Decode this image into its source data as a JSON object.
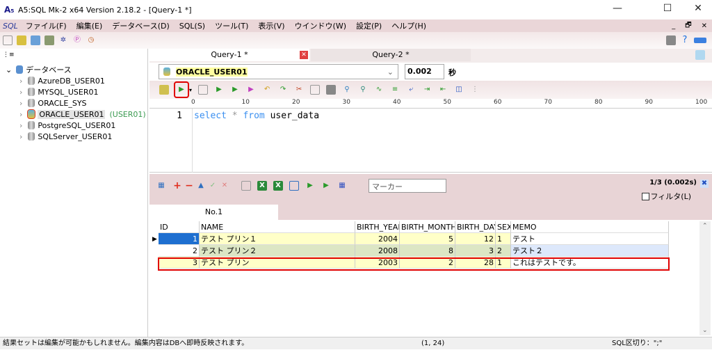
{
  "window": {
    "title": "A5:SQL Mk-2 x64 Version 2.18.2 - [Query-1 *]",
    "minimize": "—",
    "maximize": "☐",
    "close": "✕"
  },
  "menu": {
    "sql_icon": "SQL",
    "items": [
      "ファイル(F)",
      "編集(E)",
      "データベース(D)",
      "SQL(S)",
      "ツール(T)",
      "表示(V)",
      "ウインドウ(W)",
      "設定(P)",
      "ヘルプ(H)"
    ],
    "mdi_buttons": [
      "_",
      "🗗",
      "✕"
    ]
  },
  "tree": {
    "root": "データベース",
    "items": [
      {
        "label": "AzureDB_USER01"
      },
      {
        "label": "MYSQL_USER01"
      },
      {
        "label": "ORACLE_SYS"
      },
      {
        "label": "ORACLE_USER01",
        "suffix": "(USER01)",
        "selected": true
      },
      {
        "label": "PostgreSQL_USER01"
      },
      {
        "label": "SQLServer_USER01"
      }
    ]
  },
  "query_tabs": [
    {
      "label": "Query-1 *",
      "active": true
    },
    {
      "label": "Query-2 *",
      "active": false
    }
  ],
  "connection": {
    "name": "ORACLE_USER01",
    "timeout": "0.002",
    "unit": "秒"
  },
  "ruler": [
    "0",
    "10",
    "20",
    "30",
    "40",
    "50",
    "60",
    "70",
    "80",
    "90",
    "100"
  ],
  "editor": {
    "line": "1",
    "kw1": "select",
    "star": "*",
    "kw2": "from",
    "rest": "user_data"
  },
  "results": {
    "marker_placeholder": "マーカー",
    "count": "1/3 (0.002s)",
    "filter_label": "フィルタ(L)",
    "tab": "No.1",
    "columns": [
      "ID",
      "NAME",
      "BIRTH_YEAR",
      "BIRTH_MONTH",
      "BIRTH_DAY",
      "SEX",
      "MEMO"
    ],
    "rows": [
      [
        "1",
        "テスト プリン１",
        "2004",
        "5",
        "12",
        "1",
        "テスト"
      ],
      [
        "2",
        "テスト プリン２",
        "2008",
        "8",
        "3",
        "2",
        "テスト２"
      ],
      [
        "3",
        "テスト プリン",
        "2003",
        "2",
        "28",
        "1",
        "これはテストです。"
      ]
    ]
  },
  "status": {
    "message": "結果セットは編集が可能かもしれません。編集内容はDBへ即時反映されます。",
    "position": "(1, 24)",
    "delimiter": "SQL区切り：\";\""
  },
  "colors": {
    "menu_bg": "#ead6d8",
    "highlight": "#e00000",
    "selected_cell": "#1e6fd0",
    "row_yellow": "#ffffc8",
    "row_green": "#dce6c4"
  }
}
